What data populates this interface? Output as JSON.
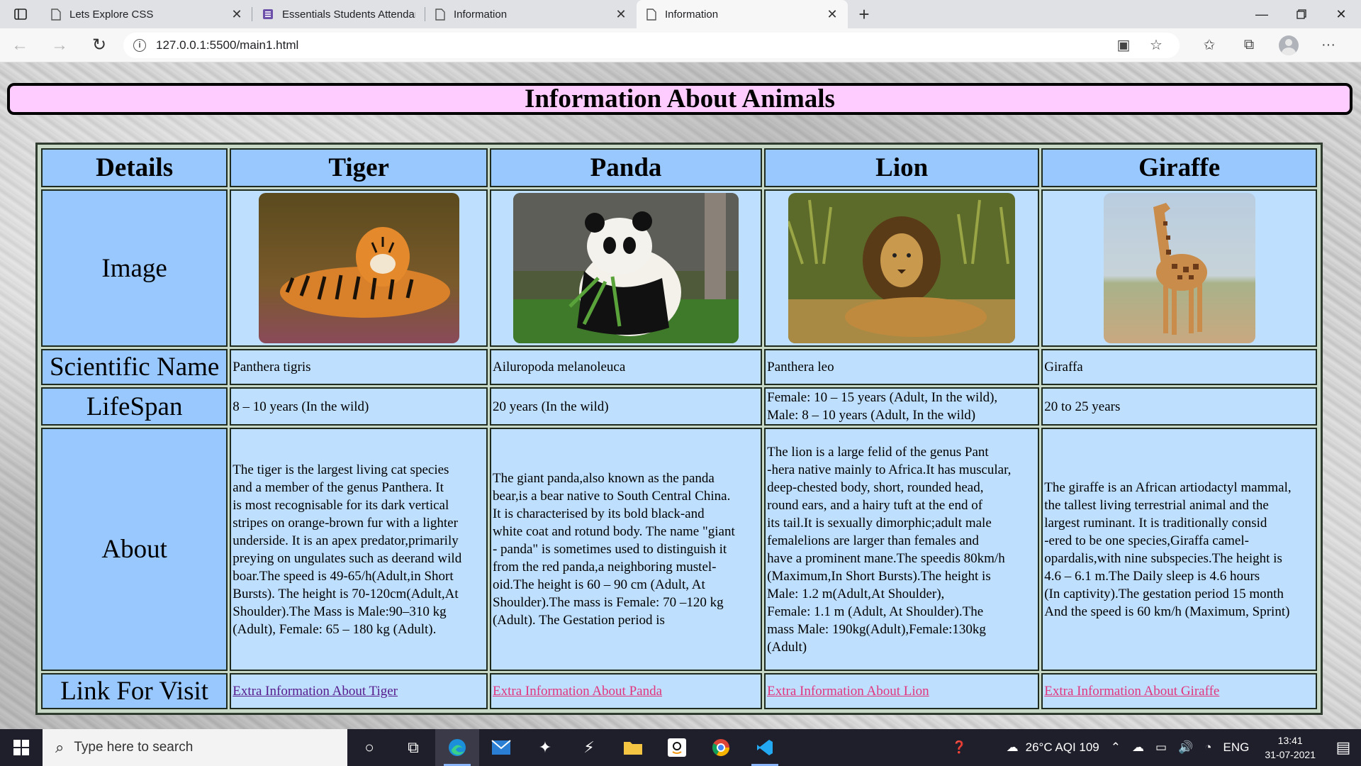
{
  "browser": {
    "tabs": [
      {
        "label": "Lets Explore CSS",
        "icon": "page-icon",
        "active": false
      },
      {
        "label": "Essentials Students Attendance f",
        "icon": "forms-icon",
        "active": false
      },
      {
        "label": "Information",
        "icon": "page-icon",
        "active": false
      },
      {
        "label": "Information",
        "icon": "page-icon",
        "active": true
      }
    ],
    "url": "127.0.0.1:5500/main1.html"
  },
  "page": {
    "title": "Information About Animals",
    "headers": [
      "Details",
      "Tiger",
      "Panda",
      "Lion",
      "Giraffe"
    ],
    "row_labels": {
      "image": "Image",
      "scientific": "Scientific Name",
      "lifespan": "LifeSpan",
      "about": "About",
      "link": "Link For Visit"
    },
    "animals": [
      {
        "name": "Tiger",
        "scientific": "Panthera tigris",
        "lifespan": [
          "8 – 10 years (In the wild)"
        ],
        "about": [
          "The tiger is the largest living cat species",
          "and a member of the genus Panthera. It",
          "is most recognisable for its dark vertical",
          "stripes on orange-brown fur with a lighter",
          "underside. It is an apex predator,primarily",
          "preying on ungulates such as deerand wild",
          "boar.The speed is 49-65/h(Adult,in Short",
          "Bursts). The height is 70-120cm(Adult,At",
          "Shoulder).The Mass is Male:90–310 kg",
          "(Adult), Female: 65 – 180 kg (Adult)."
        ],
        "link": "Extra Information About Tiger"
      },
      {
        "name": "Panda",
        "scientific": "Ailuropoda melanoleuca",
        "lifespan": [
          "20 years (In the wild)"
        ],
        "about": [
          "The giant panda,also known as the panda",
          "bear,is a bear native to South Central China.",
          "It is characterised by its bold black-and",
          "white coat and rotund body. The name \"giant",
          "- panda\" is sometimes used to distinguish it",
          "from the red panda,a neighboring mustel-",
          "oid.The height is 60 – 90 cm (Adult, At",
          "Shoulder).The mass is Female: 70 –120 kg",
          "(Adult). The Gestation period is"
        ],
        "link": "Extra Information About Panda"
      },
      {
        "name": "Lion",
        "scientific": "Panthera leo",
        "lifespan": [
          "Female: 10 – 15 years (Adult, In the wild),",
          "Male: 8 – 10 years (Adult, In the wild)"
        ],
        "about": [
          "The lion is a large felid of the genus Pant",
          "-hera native mainly to Africa.It has muscular,",
          "deep-chested body, short, rounded head,",
          "round ears, and a hairy tuft at the end of",
          "its tail.It is sexually dimorphic;adult male",
          "femalelions are larger than females and",
          "have a prominent mane.The speedis 80km/h",
          "(Maximum,In Short Bursts).The height is",
          "Male: 1.2 m(Adult,At Shoulder),",
          "Female: 1.1 m (Adult, At Shoulder).The",
          "mass Male: 190kg(Adult),Female:130kg",
          "(Adult)"
        ],
        "link": "Extra Information About Lion"
      },
      {
        "name": "Giraffe",
        "scientific": "Giraffa",
        "lifespan": [
          "20 to 25 years"
        ],
        "about": [
          "The giraffe is an African artiodactyl mammal,",
          "the tallest living terrestrial animal and the",
          "largest ruminant. It is traditionally consid",
          "-ered to be one species,Giraffa camel-",
          "opardalis,with nine subspecies.The height is",
          "4.6 – 6.1 m.The Daily sleep is 4.6 hours",
          "(In captivity).The gestation period 15 month",
          "And the speed is 60 km/h (Maximum, Sprint)"
        ],
        "link": "Extra Information About Giraffe"
      }
    ]
  },
  "taskbar": {
    "search_placeholder": "Type here to search",
    "weather": "26°C  AQI 109",
    "language": "ENG",
    "time": "13:41",
    "date": "31-07-2021"
  },
  "colors": {
    "heading_bg": "#ffccff",
    "header_cell_bg": "#99c8ff",
    "cell_bg": "#bfdfff",
    "visited_link": "#551a8b",
    "link": "#e0357d"
  }
}
